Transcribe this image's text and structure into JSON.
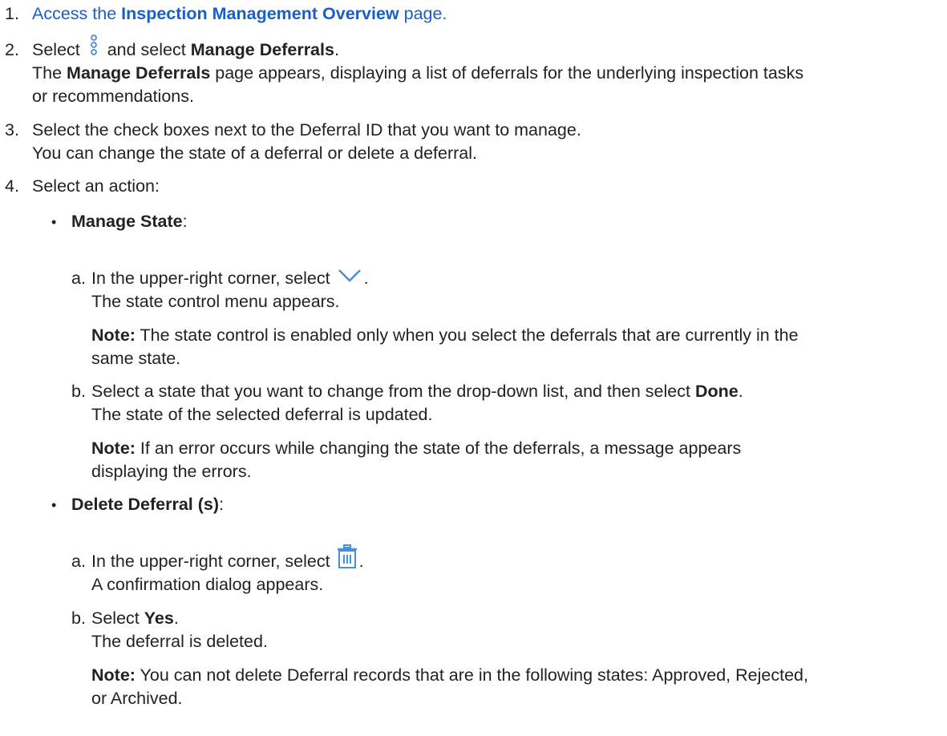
{
  "steps": [
    {
      "num": "1.",
      "pre": "Access the ",
      "link": "Inspection Management Overview",
      "post": " page."
    },
    {
      "num": "2.",
      "pre": "Select ",
      "mid": " and select ",
      "bold": "Manage Deferrals",
      "post": ".",
      "res_pre": "The ",
      "res_bold": "Manage Deferrals",
      "res_post": " page appears, displaying a list of deferrals for the underlying inspection tasks",
      "res_cont": "or recommendations."
    },
    {
      "num": "3.",
      "text": "Select the check boxes next to the Deferral ID that you want to manage.",
      "res": "You can change the state of a deferral or delete a deferral."
    },
    {
      "num": "4.",
      "text": "Select an action:"
    }
  ],
  "manage_state": {
    "bullet": "•",
    "title": "Manage State",
    "colon": ":",
    "a": {
      "label": "a.",
      "pre": "In the upper-right corner, select ",
      "post": ".",
      "res": "The state control menu appears.",
      "note_label": "Note:",
      "note": " The state control is enabled only when you select the deferrals that are currently in the",
      "note_cont": "same state."
    },
    "b": {
      "label": "b.",
      "pre": "Select a state that you want to change from the drop-down list, and then select ",
      "bold": "Done",
      "post": ".",
      "res": "The state of the selected deferral is updated.",
      "note_label": "Note:",
      "note": " If an error occurs while changing the state of the deferrals, a message appears",
      "note_cont": "displaying the errors."
    }
  },
  "delete_deferral": {
    "bullet": "•",
    "title": "Delete Deferral (s)",
    "colon": ":",
    "a": {
      "label": "a.",
      "pre": "In the upper-right corner, select ",
      "post": ".",
      "res": "A confirmation dialog appears."
    },
    "b": {
      "label": "b.",
      "pre": "Select ",
      "bold": "Yes",
      "post": ".",
      "res": "The deferral is deleted.",
      "note_label": "Note:",
      "note": " You can not delete Deferral records that are in the following states: Approved, Rejected,",
      "note_cont": "or Archived."
    }
  },
  "icons": {
    "more": "more-vertical-icon",
    "chevron": "chevron-down-icon",
    "trash": "trash-icon",
    "icon_color": "#4a90d9"
  }
}
